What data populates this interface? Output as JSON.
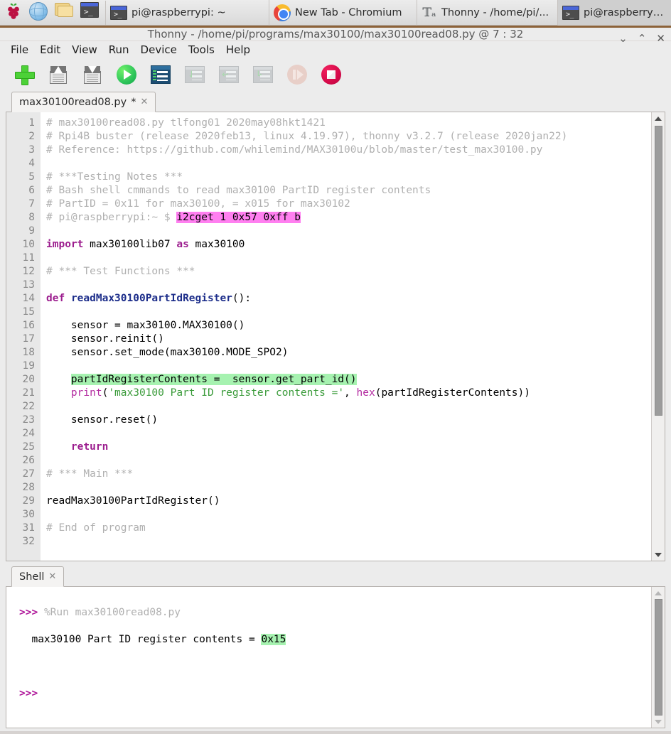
{
  "taskbar": {
    "launchers": [
      {
        "name": "raspberry-menu",
        "icon": "raspberry-pi-icon"
      },
      {
        "name": "browser-launcher",
        "icon": "globe-icon"
      },
      {
        "name": "file-manager-launcher",
        "icon": "folder-icon"
      },
      {
        "name": "terminal-launcher",
        "icon": "terminal-icon"
      }
    ],
    "tasks": [
      {
        "label": "pi@raspberrypi: ~",
        "icon": "terminal-icon",
        "active": false
      },
      {
        "label": "New Tab - Chromium",
        "icon": "chromium-icon",
        "active": false
      },
      {
        "label": "Thonny  -  /home/pi/...",
        "icon": "thonny-icon",
        "active": false
      },
      {
        "label": "pi@raspberrypi: ~",
        "icon": "terminal-icon",
        "active": true
      }
    ]
  },
  "window": {
    "title": "Thonny  -  /home/pi/programs/max30100/max30100read08.py  @  7 : 32",
    "controls": {
      "minimize": "⌄",
      "maximize": "⌃",
      "close": "✕"
    }
  },
  "menubar": {
    "items": [
      "File",
      "Edit",
      "View",
      "Run",
      "Device",
      "Tools",
      "Help"
    ]
  },
  "toolbar": {
    "buttons": [
      {
        "name": "new-file-button",
        "icon": "plus-icon",
        "enabled": true
      },
      {
        "name": "load-file-button",
        "icon": "floppy-up-icon",
        "enabled": true
      },
      {
        "name": "save-file-button",
        "icon": "floppy-down-icon",
        "enabled": true
      },
      {
        "name": "run-button",
        "icon": "run-play-icon",
        "enabled": true
      },
      {
        "name": "debug-button",
        "icon": "debug-icon",
        "enabled": true
      },
      {
        "name": "step-over-button",
        "icon": "step-over-icon",
        "enabled": false
      },
      {
        "name": "step-into-button",
        "icon": "step-into-icon",
        "enabled": false
      },
      {
        "name": "step-out-button",
        "icon": "step-out-icon",
        "enabled": false
      },
      {
        "name": "resume-button",
        "icon": "resume-icon",
        "enabled": false
      },
      {
        "name": "stop-button",
        "icon": "stop-icon",
        "enabled": true
      }
    ]
  },
  "editor": {
    "tab": {
      "label": "max30100read08.py",
      "modified_marker": "*",
      "close_glyph": "✕"
    },
    "line_count": 32,
    "line_numbers": [
      "1",
      "2",
      "3",
      "4",
      "5",
      "6",
      "7",
      "8",
      "9",
      "10",
      "11",
      "12",
      "13",
      "14",
      "15",
      "16",
      "17",
      "18",
      "19",
      "20",
      "21",
      "22",
      "23",
      "24",
      "25",
      "26",
      "27",
      "28",
      "29",
      "30",
      "31",
      "32"
    ],
    "lines": [
      {
        "n": 1,
        "text": "# max30100read08.py tlfong01 2020may08hkt1421"
      },
      {
        "n": 2,
        "text": "# Rpi4B buster (release 2020feb13, linux 4.19.97), thonny v3.2.7 (release 2020jan22)"
      },
      {
        "n": 3,
        "text": "# Reference: https://github.com/whilemind/MAX30100u/blob/master/test_max30100.py"
      },
      {
        "n": 4,
        "text": ""
      },
      {
        "n": 5,
        "text": "# ***Testing Notes ***"
      },
      {
        "n": 6,
        "text": "# Bash shell cmmands to read max30100 PartID register contents"
      },
      {
        "n": 7,
        "text": "# PartID = 0x11 for max30100, = x015 for max30102"
      },
      {
        "n": 8,
        "text": "# pi@raspberrypi:~ $ i2cget 1 0x57 0xff b",
        "highlight": "i2cget 1 0x57 0xff b",
        "highlight_color": "#ff7ff0"
      },
      {
        "n": 9,
        "text": ""
      },
      {
        "n": 10,
        "text": "import max30100lib07 as max30100"
      },
      {
        "n": 11,
        "text": ""
      },
      {
        "n": 12,
        "text": "# *** Test Functions ***"
      },
      {
        "n": 13,
        "text": ""
      },
      {
        "n": 14,
        "text": "def readMax30100PartIdRegister():"
      },
      {
        "n": 15,
        "text": ""
      },
      {
        "n": 16,
        "text": "    sensor = max30100.MAX30100()"
      },
      {
        "n": 17,
        "text": "    sensor.reinit()"
      },
      {
        "n": 18,
        "text": "    sensor.set_mode(max30100.MODE_SPO2)"
      },
      {
        "n": 19,
        "text": ""
      },
      {
        "n": 20,
        "text": "    partIdRegisterContents =  sensor.get_part_id()",
        "highlight": "partIdRegisterContents =  sensor.get_part_id()",
        "highlight_color": "#a6f2b0"
      },
      {
        "n": 21,
        "text": "    print('max30100 Part ID register contents =', hex(partIdRegisterContents))"
      },
      {
        "n": 22,
        "text": ""
      },
      {
        "n": 23,
        "text": "    sensor.reset()"
      },
      {
        "n": 24,
        "text": ""
      },
      {
        "n": 25,
        "text": "    return"
      },
      {
        "n": 26,
        "text": ""
      },
      {
        "n": 27,
        "text": "# *** Main ***"
      },
      {
        "n": 28,
        "text": ""
      },
      {
        "n": 29,
        "text": "readMax30100PartIdRegister()"
      },
      {
        "n": 30,
        "text": ""
      },
      {
        "n": 31,
        "text": "# End of program"
      },
      {
        "n": 32,
        "text": ""
      }
    ]
  },
  "shell": {
    "tab": {
      "label": "Shell",
      "close_glyph": "✕"
    },
    "prompt": ">>>",
    "run_command": "%Run max30100read08.py",
    "output_text": "  max30100 Part ID register contents = ",
    "output_value": "0x15",
    "output_value_highlight": "#a6f2b0",
    "trailing_prompt": ">>>"
  },
  "colors": {
    "keyword": "#9c1d8e",
    "function_name": "#1c2d8a",
    "builtin": "#b32aa0",
    "string": "#3a9b3a",
    "comment": "#b0b0b0",
    "highlight_pink": "#ff7ff0",
    "highlight_green": "#a6f2b0",
    "prompt": "#b0199b"
  }
}
